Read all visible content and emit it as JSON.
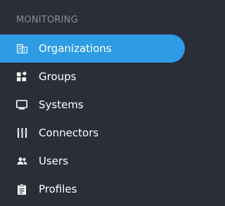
{
  "sidebar": {
    "section_title": "MONITORING",
    "items": [
      {
        "label": "Organizations",
        "icon": "building-icon",
        "active": true
      },
      {
        "label": "Groups",
        "icon": "widgets-icon",
        "active": false
      },
      {
        "label": "Systems",
        "icon": "monitor-icon",
        "active": false
      },
      {
        "label": "Connectors",
        "icon": "equalizer-icon",
        "active": false
      },
      {
        "label": "Users",
        "icon": "users-icon",
        "active": false
      },
      {
        "label": "Profiles",
        "icon": "clipboard-icon",
        "active": false
      }
    ]
  },
  "colors": {
    "background": "#2b2d38",
    "active_background": "#2d9ce4",
    "section_text": "#8a8c94",
    "item_text": "#ffffff"
  }
}
